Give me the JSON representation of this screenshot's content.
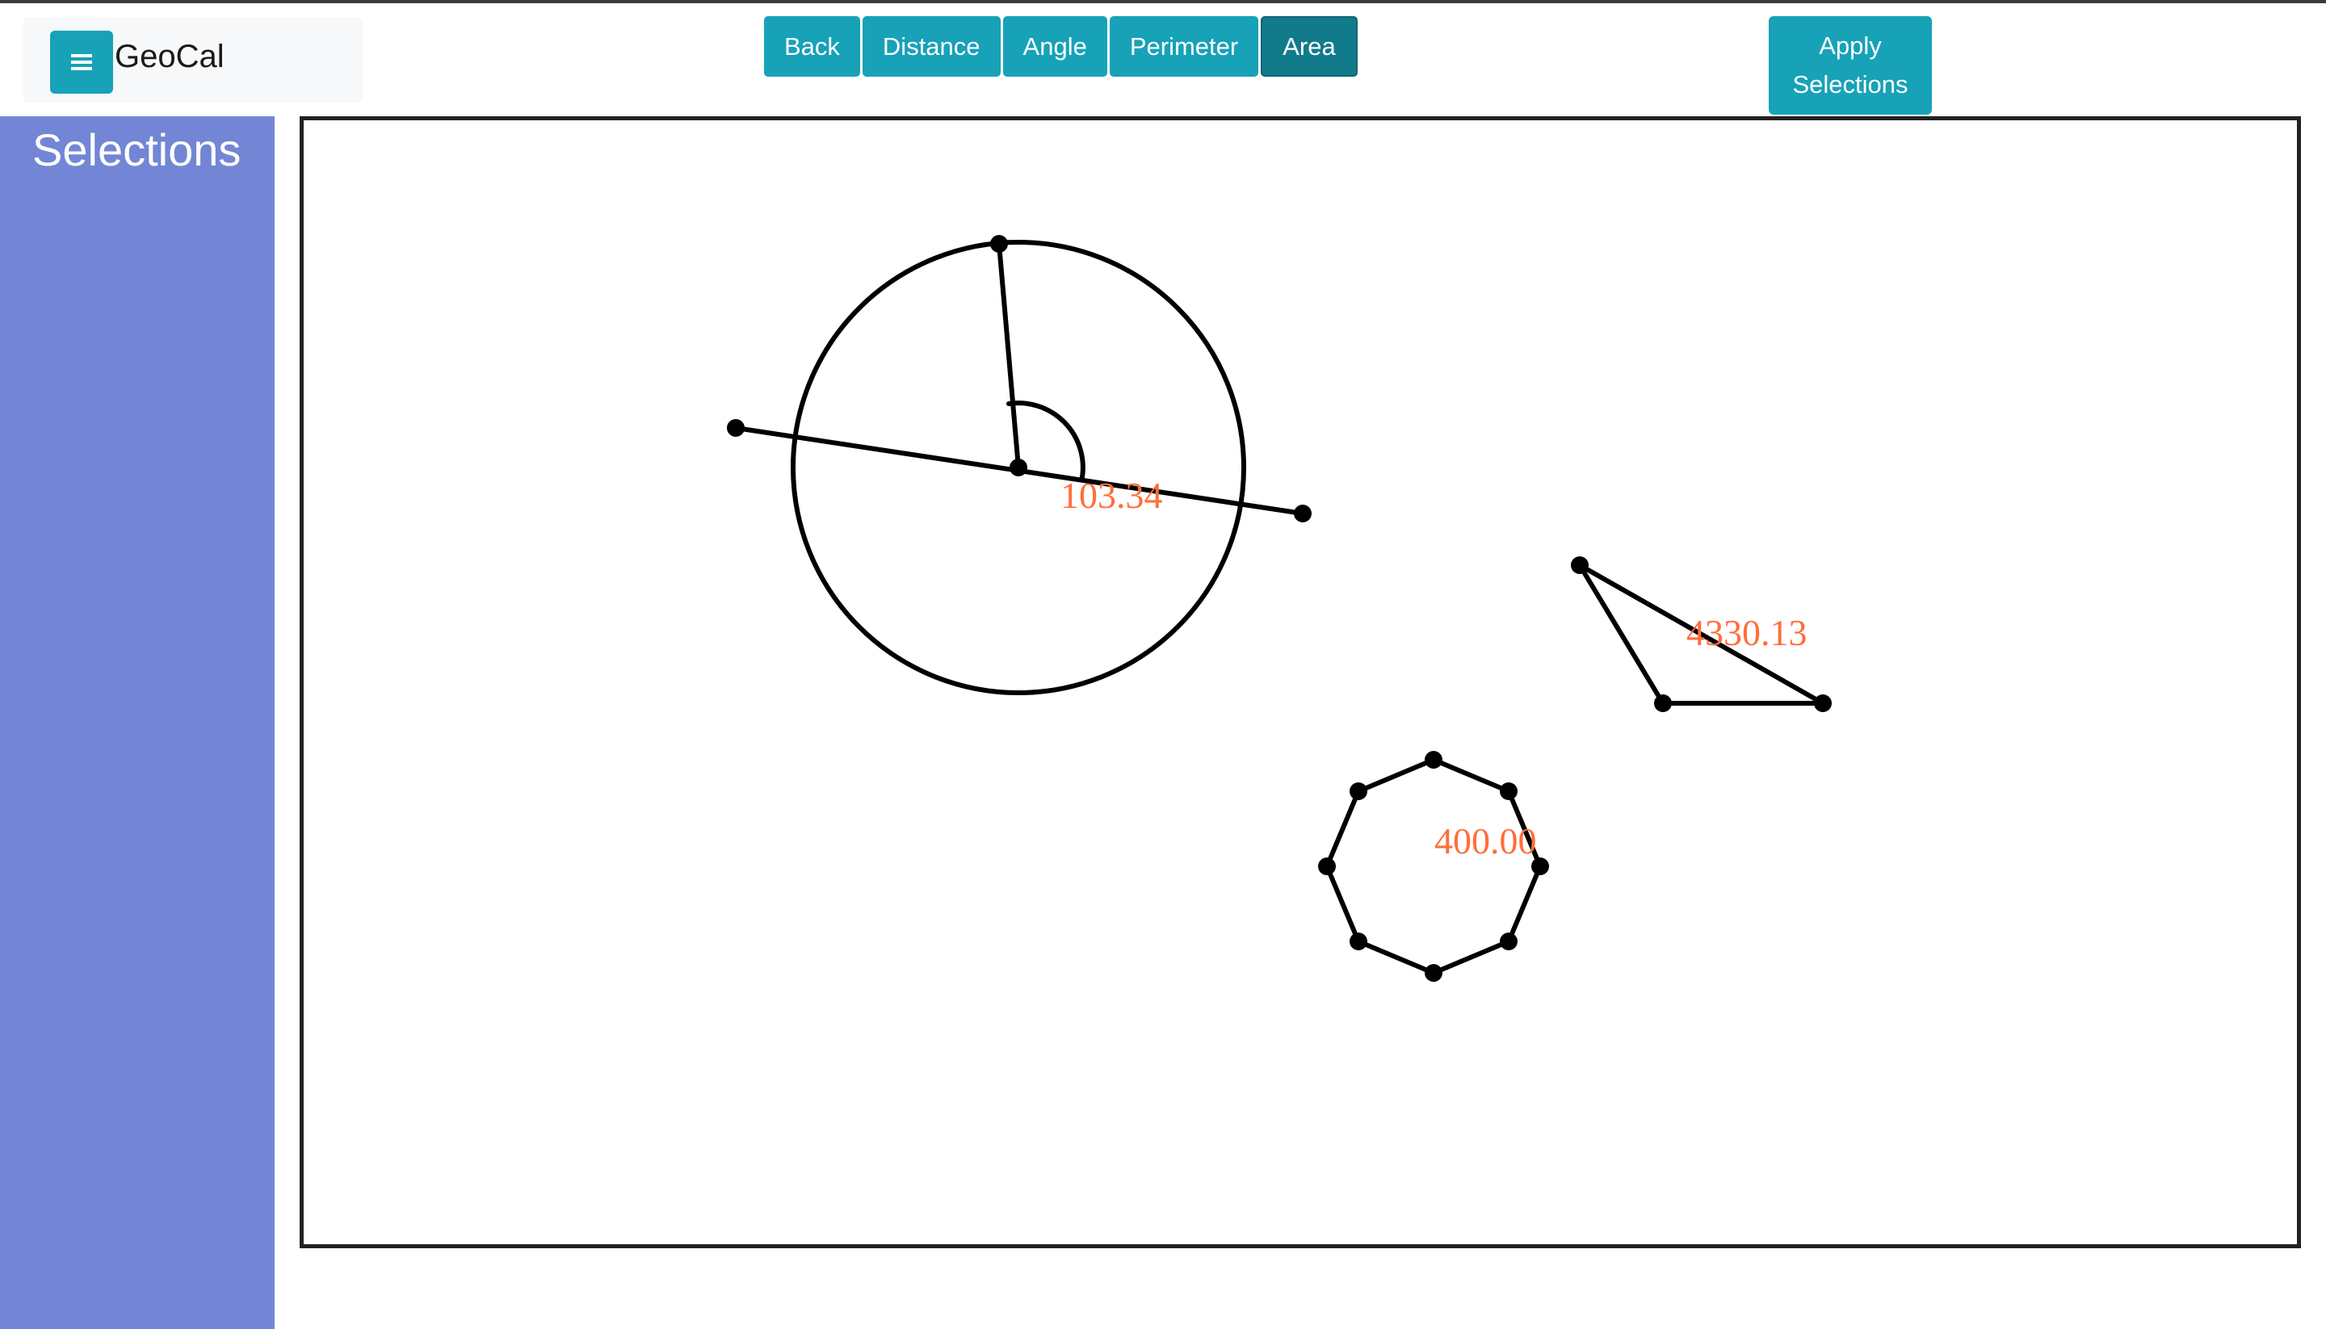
{
  "app": {
    "title": "GeoCal",
    "menu_icon": "hamburger-icon"
  },
  "toolbar": {
    "buttons": [
      {
        "label": "Back"
      },
      {
        "label": "Distance"
      },
      {
        "label": "Angle"
      },
      {
        "label": "Perimeter"
      },
      {
        "label": "Area",
        "active": true
      }
    ],
    "apply_label": "Apply Selections"
  },
  "sidebar": {
    "title": "Selections"
  },
  "canvas": {
    "angle_label": "103.34",
    "triangle_label": "4330.13",
    "octagon_label": "400.00"
  },
  "colors": {
    "accent": "#17a2b8",
    "accent_active": "#117a8b",
    "sidebar": "#7386d5",
    "measurement": "#ff6e3a",
    "shape_stroke": "#000000"
  }
}
